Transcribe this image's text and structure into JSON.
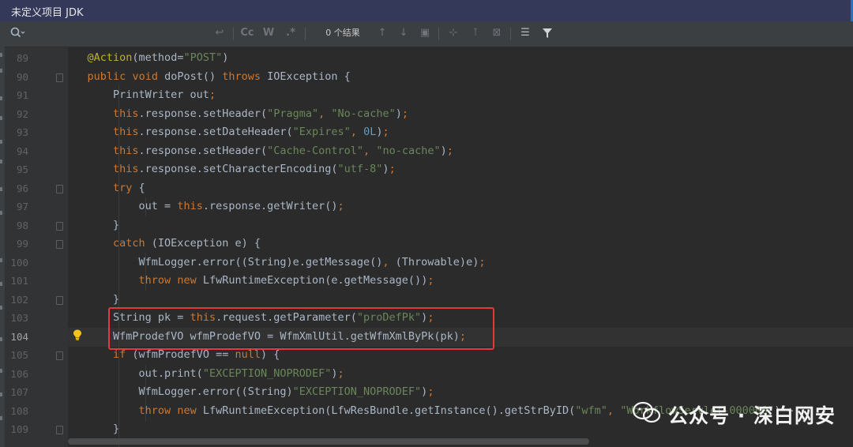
{
  "window": {
    "title": "未定义项目 JDK"
  },
  "toolbar": {
    "result_count": "0 个结果",
    "match_case": "Cc",
    "words": "W",
    "regex": ".*"
  },
  "editor": {
    "current_line": 104,
    "lines": [
      {
        "num": "89",
        "text": "    @Action(method=\"POST\")"
      },
      {
        "num": "90",
        "text": "    public void doPost() throws IOException {"
      },
      {
        "num": "91",
        "text": "        PrintWriter out;"
      },
      {
        "num": "92",
        "text": "        this.response.setHeader(\"Pragma\", \"No-cache\");"
      },
      {
        "num": "93",
        "text": "        this.response.setDateHeader(\"Expires\", 0L);"
      },
      {
        "num": "94",
        "text": "        this.response.setHeader(\"Cache-Control\", \"no-cache\");"
      },
      {
        "num": "95",
        "text": "        this.response.setCharacterEncoding(\"utf-8\");"
      },
      {
        "num": "96",
        "text": "        try {"
      },
      {
        "num": "97",
        "text": "            out = this.response.getWriter();"
      },
      {
        "num": "98",
        "text": "        }"
      },
      {
        "num": "99",
        "text": "        catch (IOException e) {"
      },
      {
        "num": "100",
        "text": "            WfmLogger.error((String)e.getMessage(), (Throwable)e);"
      },
      {
        "num": "101",
        "text": "            throw new LfwRuntimeException(e.getMessage());"
      },
      {
        "num": "102",
        "text": "        }"
      },
      {
        "num": "103",
        "text": "        String pk = this.request.getParameter(\"proDefPk\");"
      },
      {
        "num": "104",
        "text": "        WfmProdefVO wfmProdefVO = WfmXmlUtil.getWfmXmlByPk(pk);"
      },
      {
        "num": "105",
        "text": "        if (wfmProdefVO == null) {"
      },
      {
        "num": "106",
        "text": "            out.print(\"EXCEPTION_NOPRODEF\");"
      },
      {
        "num": "107",
        "text": "            WfmLogger.error((String)\"EXCEPTION_NOPRODEF\");"
      },
      {
        "num": "108",
        "text": "            throw new LfwRuntimeException(LfwResBundle.getInstance().getStrByID(\"wfm\", \"WorkflowServlet-000000\") +"
      },
      {
        "num": "109",
        "text": "        }"
      }
    ]
  },
  "watermark": {
    "text": "公众号 · 深白网安"
  },
  "colors": {
    "keyword": "#cc7832",
    "string": "#6a8759",
    "number": "#6897bb",
    "annotation": "#bbb529",
    "text": "#a9b7c6",
    "highlight_box": "#e0393e"
  }
}
